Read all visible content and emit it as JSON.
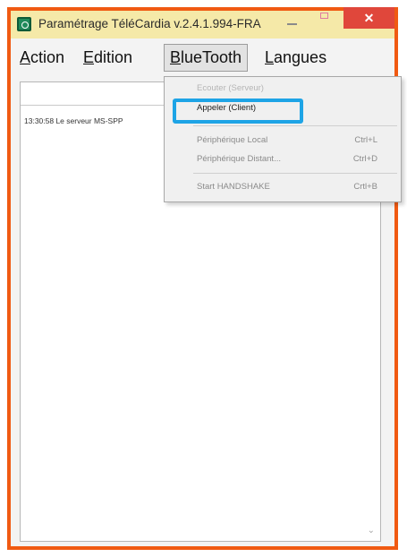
{
  "window": {
    "title": "Paramétrage TéléCardia v.2.4.1.994-FRA",
    "close_glyph": "✕",
    "border_color": "#f05a12",
    "titlebar_color": "#f5e9a8"
  },
  "menubar": {
    "items": [
      {
        "label": "Action"
      },
      {
        "label": "Edition"
      },
      {
        "label": "BlueTooth"
      },
      {
        "label": "Langues"
      }
    ]
  },
  "main": {
    "input_value": "",
    "log_lines": [
      "13:30:58 Le serveur MS-SPP"
    ]
  },
  "bluetooth_menu": {
    "items": [
      {
        "label": "Ecouter (Serveur)",
        "shortcut": "",
        "state": "disabled"
      },
      {
        "label": "Appeler (Client)",
        "shortcut": "",
        "state": "enabled"
      },
      {
        "label": "Périphérique Local",
        "shortcut": "Ctrl+L",
        "state": "disabled"
      },
      {
        "label": "Périphérique Distant...",
        "shortcut": "Ctrl+D",
        "state": "disabled"
      },
      {
        "label": "Start HANDSHAKE",
        "shortcut": "Crtl+B",
        "state": "disabled"
      }
    ]
  },
  "highlight": {
    "color": "#1ea4e6"
  }
}
